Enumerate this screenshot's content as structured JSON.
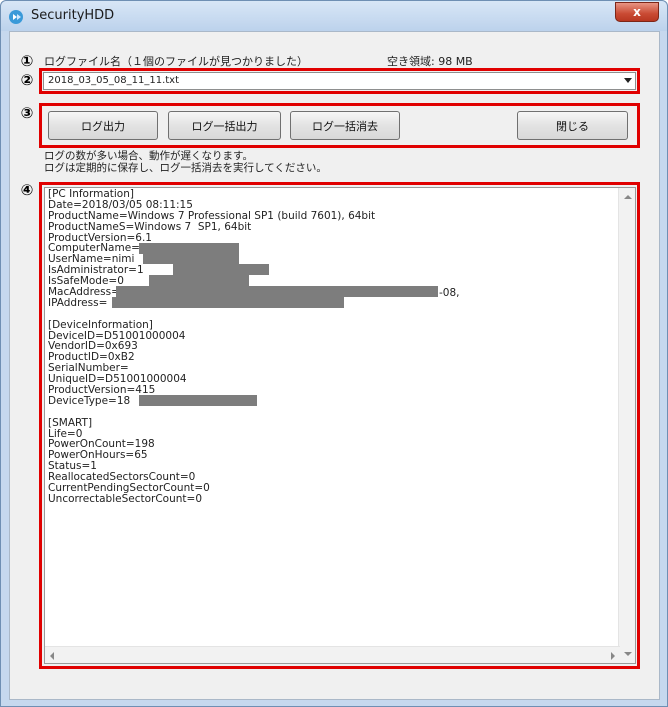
{
  "window": {
    "title": "SecurityHDD",
    "close_label": "x"
  },
  "markers": [
    "①",
    "②",
    "③",
    "④"
  ],
  "header": {
    "log_file_info": "ログファイル名（１個のファイルが見つかりました）",
    "free_space": "空き領域: 98 MB"
  },
  "file_select": {
    "selected": "2018_03_05_08_11_11.txt"
  },
  "buttons": {
    "log_output": "ログ出力",
    "log_bulk_output": "ログ一括出力",
    "log_bulk_delete": "ログ一括消去",
    "close": "閉じる"
  },
  "notes": [
    "ログの数が多い場合、動作が遅くなります。",
    "ログは定期的に保存し、ログ一括消去を実行してください。"
  ],
  "log_lines": [
    "[PC Information]",
    "Date=2018/03/05 08:11:15",
    "ProductName=Windows 7 Professional SP1 (build 7601), 64bit",
    "ProductNameS=Windows 7  SP1, 64bit",
    "ProductVersion=6.1",
    "ComputerName=",
    "UserName=nimi",
    "IsAdministrator=1",
    "IsSafeMode=0",
    "MacAddress=",
    "IPAddress=",
    "",
    "[DeviceInformation]",
    "DeviceID=D51001000004",
    "VendorID=0x693",
    "ProductID=0xB2",
    "SerialNumber=",
    "UniqueID=D51001000004",
    "ProductVersion=415",
    "DeviceType=18",
    "",
    "[SMART]",
    "Life=0",
    "PowerOnCount=198",
    "PowerOnHours=65",
    "Status=1",
    "ReallocatedSectorsCount=0",
    "CurrentPendingSectorCount=0",
    "UncorrectableSectorCount=0"
  ],
  "mac_suffix": "-08,",
  "colors": {
    "highlight": "#e00000",
    "titlebar": "#bcd2ec",
    "close": "#c94a33"
  }
}
